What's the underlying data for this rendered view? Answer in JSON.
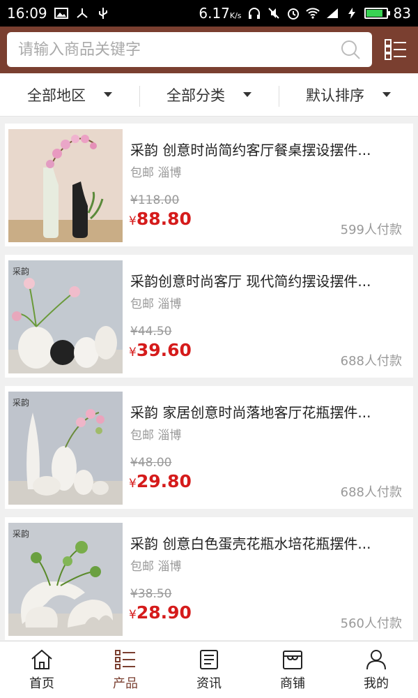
{
  "status": {
    "time": "16:09",
    "speed": "6.17",
    "speed_unit": "K/s",
    "battery": "83",
    "battery_level": 0.83
  },
  "search": {
    "placeholder": "请输入商品关键字"
  },
  "filters": [
    {
      "label": "全部地区"
    },
    {
      "label": "全部分类"
    },
    {
      "label": "默认排序"
    }
  ],
  "products": [
    {
      "title": "采韵 创意时尚简约客厅餐桌摆设摆件...",
      "shipping": "包邮",
      "location": "淄博",
      "old_price": "¥118.00",
      "price_symbol": "¥",
      "price": "88.80",
      "paid": "599人付款"
    },
    {
      "title": "采韵创意时尚客厅 现代简约摆设摆件...",
      "shipping": "包邮",
      "location": "淄博",
      "old_price": "¥44.50",
      "price_symbol": "¥",
      "price": "39.60",
      "paid": "688人付款"
    },
    {
      "title": "采韵 家居创意时尚落地客厅花瓶摆件...",
      "shipping": "包邮",
      "location": "淄博",
      "old_price": "¥48.00",
      "price_symbol": "¥",
      "price": "29.80",
      "paid": "688人付款"
    },
    {
      "title": "采韵 创意白色蛋壳花瓶水培花瓶摆件...",
      "shipping": "包邮",
      "location": "淄博",
      "old_price": "¥38.50",
      "price_symbol": "¥",
      "price": "28.90",
      "paid": "560人付款"
    }
  ],
  "thumb_marks": [
    "采韵",
    "采韵",
    "采韵"
  ],
  "nav": [
    {
      "label": "首页",
      "icon": "home-icon"
    },
    {
      "label": "产品",
      "icon": "product-list-icon"
    },
    {
      "label": "资讯",
      "icon": "news-icon"
    },
    {
      "label": "商铺",
      "icon": "shop-icon"
    },
    {
      "label": "我的",
      "icon": "user-icon"
    }
  ],
  "colors": {
    "brand": "#7a3f30",
    "price": "#d51b1b",
    "status_bar": "#000000",
    "battery": "#39d353"
  }
}
